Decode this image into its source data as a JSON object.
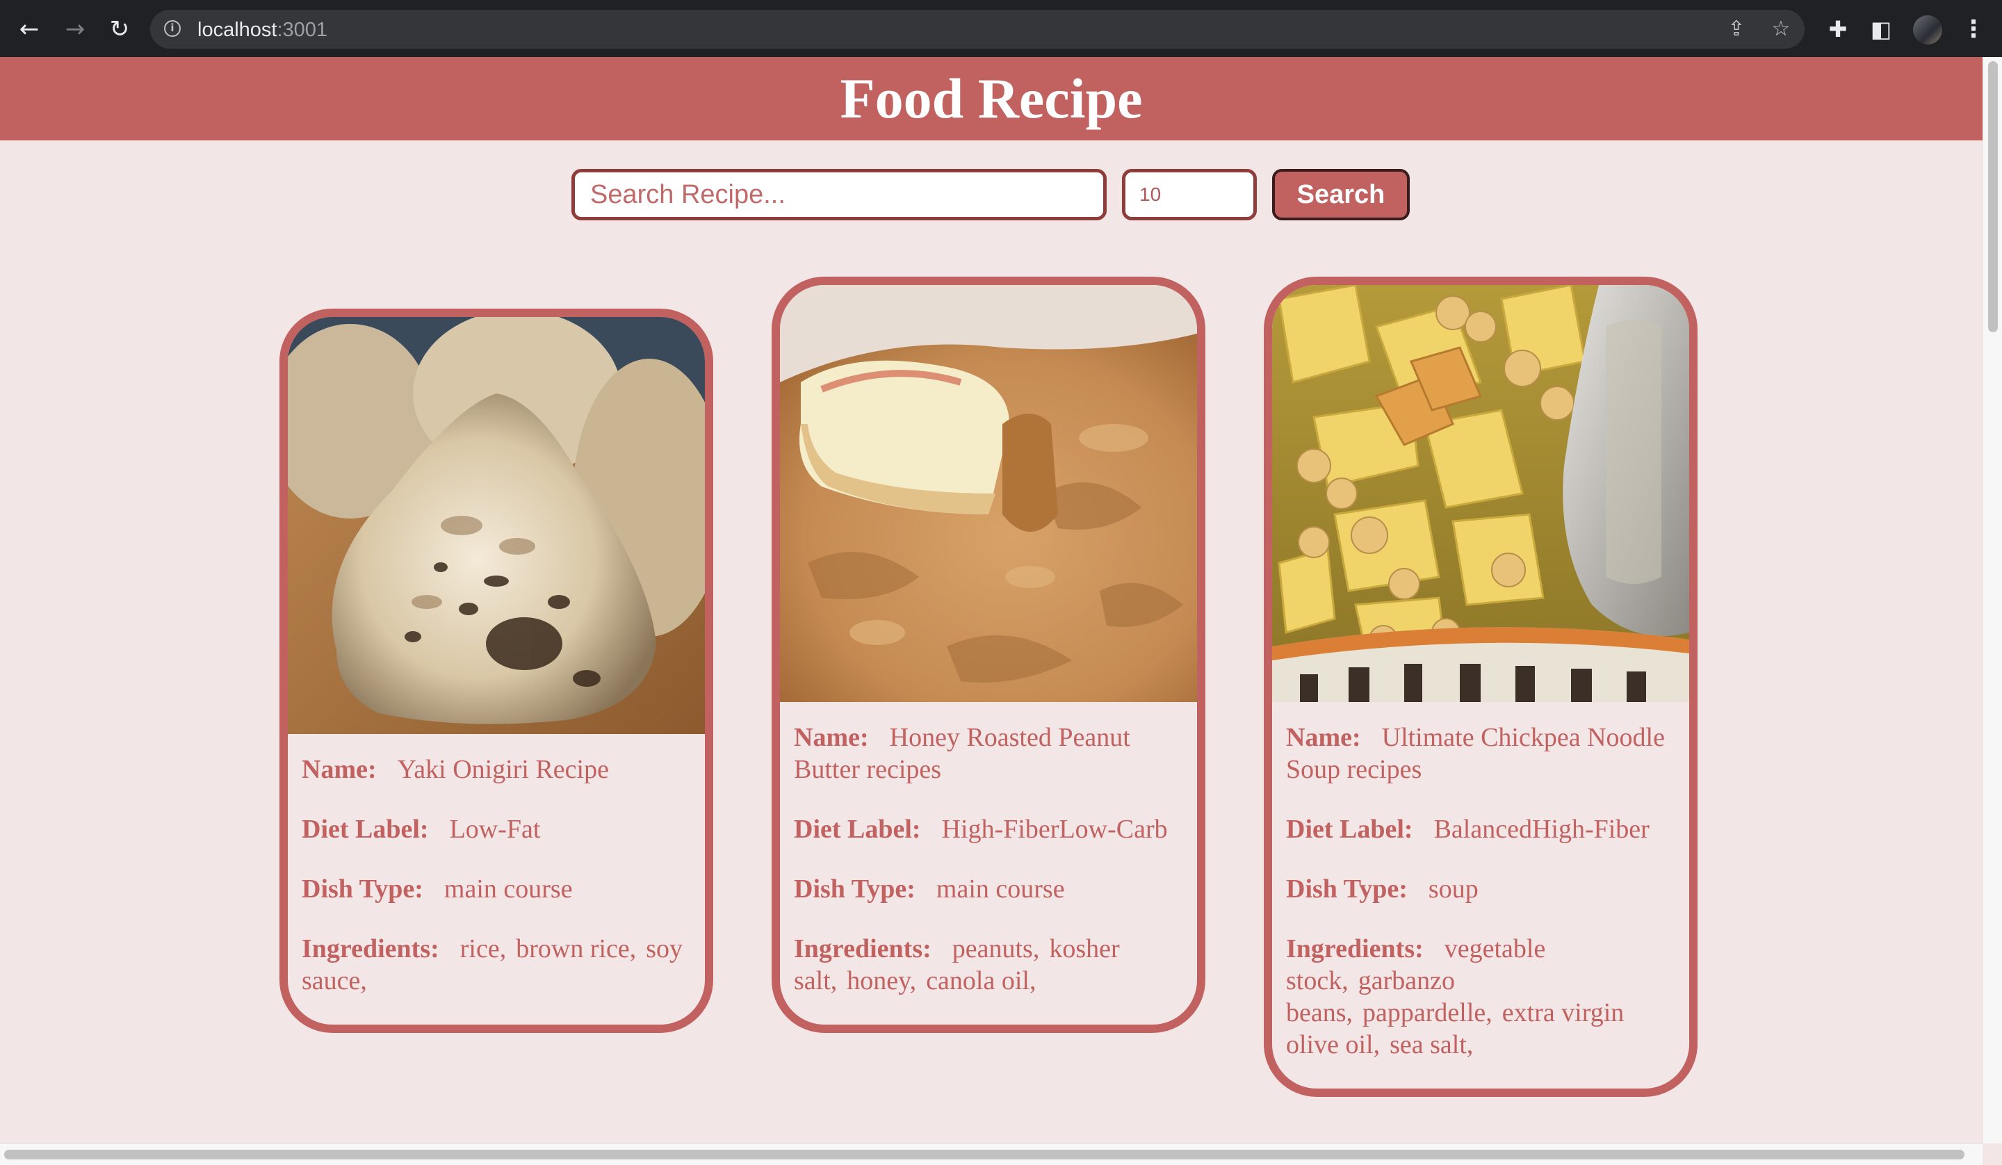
{
  "browser": {
    "url_host": "localhost",
    "url_port": ":3001",
    "back_glyph": "←",
    "forward_glyph": "→",
    "reload_glyph": "↻",
    "info_glyph": "i",
    "share_glyph": "⇪",
    "star_glyph": "☆",
    "extensions_glyph": "✚",
    "sidepanel_glyph": "◧",
    "menu_glyph": "⋮"
  },
  "header": {
    "title": "Food Recipe"
  },
  "search": {
    "query_placeholder": "Search Recipe...",
    "query_value": "",
    "count_value": "10",
    "button_label": "Search"
  },
  "labels": {
    "name": "Name:",
    "diet": "Diet Label:",
    "dish": "Dish Type:",
    "ingredients": "Ingredients:"
  },
  "recipes": [
    {
      "name": "Yaki Onigiri Recipe",
      "diet": "Low-Fat",
      "dish": "main course",
      "ingredients": [
        "rice,",
        "brown rice,",
        "soy sauce,"
      ]
    },
    {
      "name": "Honey Roasted Peanut Butter recipes",
      "diet": "High-FiberLow-Carb",
      "dish": "main course",
      "ingredients": [
        "peanuts,",
        "kosher salt,",
        "honey,",
        "canola oil,"
      ]
    },
    {
      "name": "Ultimate Chickpea Noodle Soup recipes",
      "diet": "BalancedHigh-Fiber",
      "dish": "soup",
      "ingredients": [
        "vegetable stock,",
        "garbanzo beans,",
        "pappardelle,",
        "extra virgin olive oil,",
        "sea salt,"
      ]
    }
  ],
  "colors": {
    "accent": "#c26260",
    "page_background": "#f3e6e6",
    "input_border": "#8e3d3b"
  }
}
